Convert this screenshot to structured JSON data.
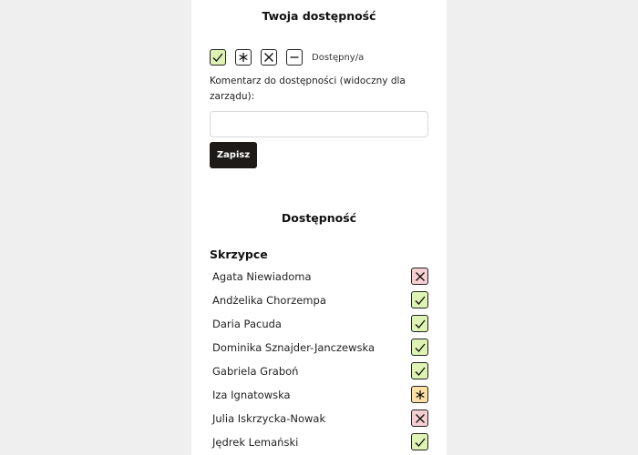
{
  "availability_form": {
    "title": "Twoja dostępność",
    "options": [
      {
        "icon": "check-icon",
        "name": "status-option-available",
        "selected": true
      },
      {
        "icon": "asterisk-icon",
        "name": "status-option-maybe",
        "selected": false
      },
      {
        "icon": "cross-icon",
        "name": "status-option-unavailable",
        "selected": false
      },
      {
        "icon": "dash-icon",
        "name": "status-option-none",
        "selected": false
      }
    ],
    "selected_label": "Dostępny/a",
    "comment_label": "Komentarz do dostępności (widoczny dla zarządu):",
    "comment_value": "",
    "save_label": "Zapisz"
  },
  "availability_list": {
    "title": "Dostępność",
    "section": "Skrzypce",
    "people": [
      {
        "name": "Agata Niewiadoma",
        "status": "unavailable"
      },
      {
        "name": "Andżelika Chorzempa",
        "status": "available"
      },
      {
        "name": "Daria Pacuda",
        "status": "available"
      },
      {
        "name": "Dominika Sznajder-Janczewska",
        "status": "available"
      },
      {
        "name": "Gabriela Graboń",
        "status": "available"
      },
      {
        "name": "Iza Ignatowska",
        "status": "maybe"
      },
      {
        "name": "Julia Iskrzycka-Nowak",
        "status": "unavailable"
      },
      {
        "name": "Jędrek Lemański",
        "status": "available"
      }
    ]
  },
  "colors": {
    "available": "#dff3b4",
    "maybe": "#fce0a6",
    "unavailable": "#f6cfd4",
    "button_dark": "#1e1a17"
  }
}
